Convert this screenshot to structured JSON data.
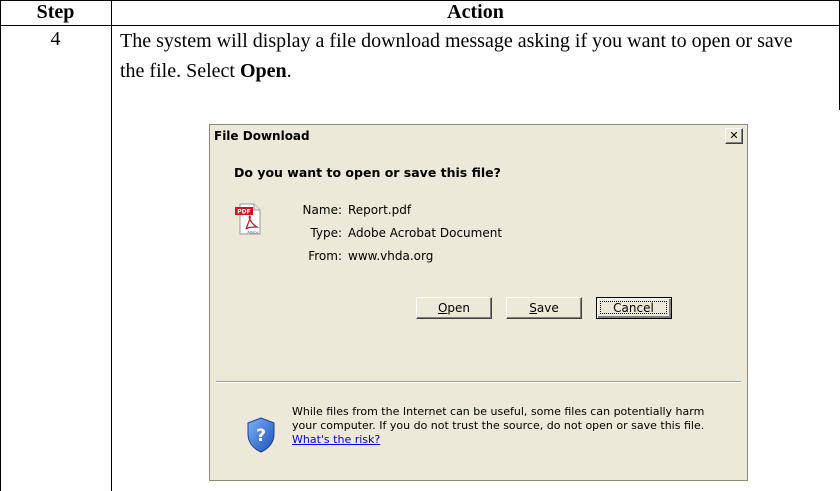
{
  "table": {
    "header_step": "Step",
    "header_action": "Action",
    "step_number": "4",
    "action_text_before": "The system will display a file download message asking if you want to open or save the file. Select ",
    "action_text_bold": "Open",
    "action_text_after": "."
  },
  "dialog": {
    "title": "File Download",
    "close_label": "✕",
    "question": "Do you want to open or save this file?",
    "file_icon": "pdf-file-icon",
    "name_label": "Name:",
    "name_value": "Report.pdf",
    "type_label": "Type:",
    "type_value": "Adobe Acrobat Document",
    "from_label": "From:",
    "from_value": "www.vhda.org",
    "open_button": {
      "accel": "O",
      "rest": "pen"
    },
    "save_button": {
      "accel": "S",
      "rest": "ave"
    },
    "cancel_button": "Cancel",
    "warning_icon": "shield-question-icon",
    "warning_text": "While files from the Internet can be useful, some files can potentially harm your computer. If you do not trust the source, do not open or save this file.",
    "warning_link": "What's the risk?"
  }
}
